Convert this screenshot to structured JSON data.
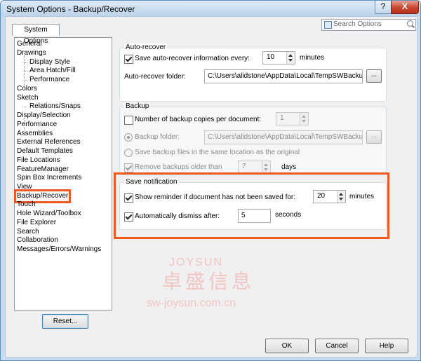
{
  "window": {
    "title": "System Options - Backup/Recover",
    "help_glyph": "?",
    "close_glyph": "X"
  },
  "search": {
    "placeholder": "Search Options"
  },
  "tab": {
    "label": "System Options"
  },
  "tree": {
    "items": [
      "General",
      "Drawings",
      "Display Style",
      "Area Hatch/Fill",
      "Performance",
      "Colors",
      "Sketch",
      "Relations/Snaps",
      "Display/Selection",
      "Performance",
      "Assemblies",
      "External References",
      "Default Templates",
      "File Locations",
      "FeatureManager",
      "Spin Box Increments",
      "View",
      "Backup/Recover",
      "Touch",
      "Hole Wizard/Toolbox",
      "File Explorer",
      "Search",
      "Collaboration",
      "Messages/Errors/Warnings"
    ],
    "selected": "Backup/Recover"
  },
  "reset_label": "Reset...",
  "autorecover": {
    "title": "Auto-recover",
    "save_label": "Save auto-recover information every:",
    "save_checked": true,
    "interval_value": "10",
    "interval_unit": "minutes",
    "folder_label": "Auto-recover folder:",
    "folder_value": "C:\\Users\\alidstone\\AppData\\Local\\TempSWBackupDirectory",
    "browse_label": "..."
  },
  "backup": {
    "title": "Backup",
    "copies_label": "Number of backup copies per document:",
    "copies_checked": false,
    "copies_value": "1",
    "folder_label": "Backup folder:",
    "folder_value": "C:\\Users\\alidstone\\AppData\\Local\\TempSWBackupDirectory",
    "browse_label": "...",
    "same_location_label": "Save backup files in the same location as the original",
    "remove_label": "Remove backups older than",
    "remove_checked": true,
    "remove_value": "7",
    "remove_unit": "days"
  },
  "save_notification": {
    "title": "Save notification",
    "reminder_label": "Show reminder if document has not been saved for:",
    "reminder_checked": true,
    "reminder_value": "20",
    "reminder_unit": "minutes",
    "dismiss_label": "Automatically dismiss after:",
    "dismiss_checked": true,
    "dismiss_value": "5",
    "dismiss_unit": "seconds"
  },
  "buttons": {
    "ok": "OK",
    "cancel": "Cancel",
    "help": "Help"
  },
  "watermark": {
    "brand": "JOYSUN",
    "cn": "卓盛信息",
    "url": "sw-joysun.com.cn"
  },
  "colors": {
    "highlight": "#f05a22",
    "title_bar": "#c7dcef"
  }
}
